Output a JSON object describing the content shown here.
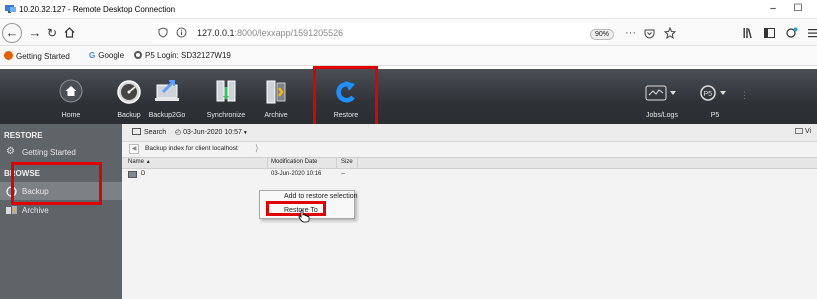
{
  "window": {
    "title": "10.20.32.127 - Remote Desktop Connection",
    "minimize": "–",
    "maximize": "☐"
  },
  "browser": {
    "url_host": "127.0.0.1",
    "url_rest": ":8000/lexxapp/1591205526",
    "zoom": "90%",
    "more": "···"
  },
  "bookmarks": [
    {
      "label": "Getting Started",
      "color": "#e66000"
    },
    {
      "label": "Google",
      "color": "#4285f4"
    },
    {
      "label": "P5 Login: SD32127W19",
      "color": "#555555"
    }
  ],
  "toolbar": {
    "home": "Home",
    "backup": "Backup",
    "backup2go": "Backup2Go",
    "synchronize": "Synchronize",
    "archive": "Archive",
    "restore": "Restore",
    "jobs_logs": "Jobs/Logs",
    "p5": "P5"
  },
  "sidebar": {
    "restore_header": "RESTORE",
    "getting_started": "Getting Started",
    "browse_header": "BROWSE",
    "backup": "Backup",
    "archive": "Archive"
  },
  "content": {
    "search": "Search",
    "date_selector": "03-Jun-2020 10:57",
    "view": "Vi",
    "breadcrumb": "Backup index for client localhost",
    "columns": {
      "name": "Name",
      "modified": "Modification Date",
      "size": "Size"
    },
    "rows": [
      {
        "name": "D",
        "modified": "03-Jun-2020 10:16",
        "size": "--"
      }
    ]
  },
  "context_menu": {
    "add": "Add to restore selection",
    "restore_to": "Restore To"
  },
  "colors": {
    "highlight": "#e00000",
    "restore_accent": "#1e90ff",
    "toolbar_bg": "#2f3338",
    "sidebar_bg": "#5f6469"
  }
}
